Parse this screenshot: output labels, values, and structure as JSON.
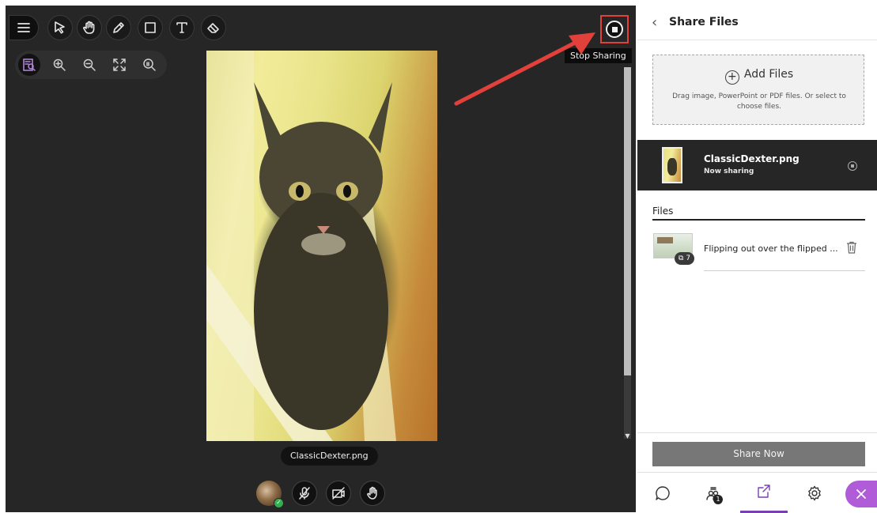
{
  "stage": {
    "tooltip": "Stop Sharing",
    "image_caption": "ClassicDexter.png",
    "toolbar_icons": [
      "menu-icon",
      "pointer-icon",
      "hand-icon",
      "pencil-icon",
      "rectangle-icon",
      "text-icon",
      "eraser-icon"
    ],
    "zoom_icons": [
      "fit-page-icon",
      "zoom-in-icon",
      "zoom-out-icon",
      "fullscreen-icon",
      "actual-size-icon"
    ],
    "bottom_controls": [
      "avatar",
      "microphone-off-icon",
      "camera-off-icon",
      "raise-hand-icon"
    ]
  },
  "panel": {
    "title": "Share Files",
    "add_files_label": "Add Files",
    "drop_hint": "Drag image, PowerPoint or PDF files. Or select to choose files.",
    "now_sharing": {
      "filename": "ClassicDexter.png",
      "status": "Now sharing"
    },
    "files_heading": "Files",
    "files": [
      {
        "name": "Flipping out over the flipped ...",
        "page_count": "7"
      }
    ],
    "share_now_label": "Share Now",
    "nav": {
      "people_count": "1",
      "icons": [
        "chat-icon",
        "people-icon",
        "share-content-icon",
        "settings-icon",
        "close-icon"
      ]
    }
  },
  "colors": {
    "accent": "#7a3fb5",
    "highlight": "#e2413b",
    "close_button": "#b05bd8"
  }
}
